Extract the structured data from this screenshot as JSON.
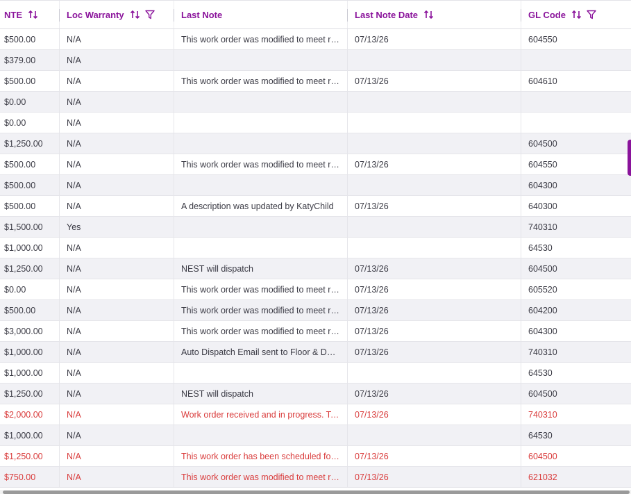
{
  "columns": [
    {
      "label": "NTE",
      "sortable": true,
      "filterable": false
    },
    {
      "label": "Loc Warranty",
      "sortable": true,
      "filterable": true
    },
    {
      "label": "Last Note",
      "sortable": false,
      "filterable": false
    },
    {
      "label": "Last Note Date",
      "sortable": true,
      "filterable": false
    },
    {
      "label": "GL Code",
      "sortable": true,
      "filterable": true
    }
  ],
  "icons": {
    "sort": "sort-arrows-icon",
    "filter": "filter-funnel-icon"
  },
  "colors": {
    "accent": "#8a139b",
    "alert_text": "#d93b3b",
    "text": "#3b3b45",
    "alt_row": "#f1f1f5"
  },
  "rows": [
    {
      "nte": "$500.00",
      "warranty": "N/A",
      "note": "This work order was modified to meet requirements",
      "date": "07/13/26",
      "gl": "604550",
      "alert": false
    },
    {
      "nte": "$379.00",
      "warranty": "N/A",
      "note": "",
      "date": "",
      "gl": "",
      "alert": false
    },
    {
      "nte": "$500.00",
      "warranty": "N/A",
      "note": "This work order was modified to meet requirements",
      "date": "07/13/26",
      "gl": "604610",
      "alert": false
    },
    {
      "nte": "$0.00",
      "warranty": "N/A",
      "note": "",
      "date": "",
      "gl": "",
      "alert": false
    },
    {
      "nte": "$0.00",
      "warranty": "N/A",
      "note": "",
      "date": "",
      "gl": "",
      "alert": false
    },
    {
      "nte": "$1,250.00",
      "warranty": "N/A",
      "note": "",
      "date": "",
      "gl": "604500",
      "alert": false
    },
    {
      "nte": "$500.00",
      "warranty": "N/A",
      "note": "This work order was modified to meet requirements",
      "date": "07/13/26",
      "gl": "604550",
      "alert": false
    },
    {
      "nte": "$500.00",
      "warranty": "N/A",
      "note": "",
      "date": "",
      "gl": "604300",
      "alert": false
    },
    {
      "nte": "$500.00",
      "warranty": "N/A",
      "note": "A description was updated by KatyChild",
      "date": "07/13/26",
      "gl": "640300",
      "alert": false
    },
    {
      "nte": "$1,500.00",
      "warranty": "Yes",
      "note": "",
      "date": "",
      "gl": "740310",
      "alert": false
    },
    {
      "nte": "$1,000.00",
      "warranty": "N/A",
      "note": "",
      "date": "",
      "gl": "64530",
      "alert": false
    },
    {
      "nte": "$1,250.00",
      "warranty": "N/A",
      "note": "NEST will dispatch",
      "date": "07/13/26",
      "gl": "604500",
      "alert": false
    },
    {
      "nte": "$0.00",
      "warranty": "N/A",
      "note": "This work order was modified to meet requirements",
      "date": "07/13/26",
      "gl": "605520",
      "alert": false
    },
    {
      "nte": "$500.00",
      "warranty": "N/A",
      "note": "This work order was modified to meet requirements",
      "date": "07/13/26",
      "gl": "604200",
      "alert": false
    },
    {
      "nte": "$3,000.00",
      "warranty": "N/A",
      "note": "This work order was modified to meet requirements",
      "date": "07/13/26",
      "gl": "604300",
      "alert": false
    },
    {
      "nte": "$1,000.00",
      "warranty": "N/A",
      "note": "Auto Dispatch Email sent to Floor & Door team",
      "date": "07/13/26",
      "gl": "740310",
      "alert": false
    },
    {
      "nte": "$1,000.00",
      "warranty": "N/A",
      "note": "",
      "date": "",
      "gl": "64530",
      "alert": false
    },
    {
      "nte": "$1,250.00",
      "warranty": "N/A",
      "note": "NEST will dispatch",
      "date": "07/13/26",
      "gl": "604500",
      "alert": false
    },
    {
      "nte": "$2,000.00",
      "warranty": "N/A",
      "note": "Work order received and in progress. Technician",
      "date": "07/13/26",
      "gl": "740310",
      "alert": true
    },
    {
      "nte": "$1,000.00",
      "warranty": "N/A",
      "note": "",
      "date": "",
      "gl": "64530",
      "alert": false
    },
    {
      "nte": "$1,250.00",
      "warranty": "N/A",
      "note": "This work order has been scheduled for service",
      "date": "07/13/26",
      "gl": "604500",
      "alert": true
    },
    {
      "nte": "$750.00",
      "warranty": "N/A",
      "note": "This work order was modified to meet requirements",
      "date": "07/13/26",
      "gl": "621032",
      "alert": true
    }
  ]
}
